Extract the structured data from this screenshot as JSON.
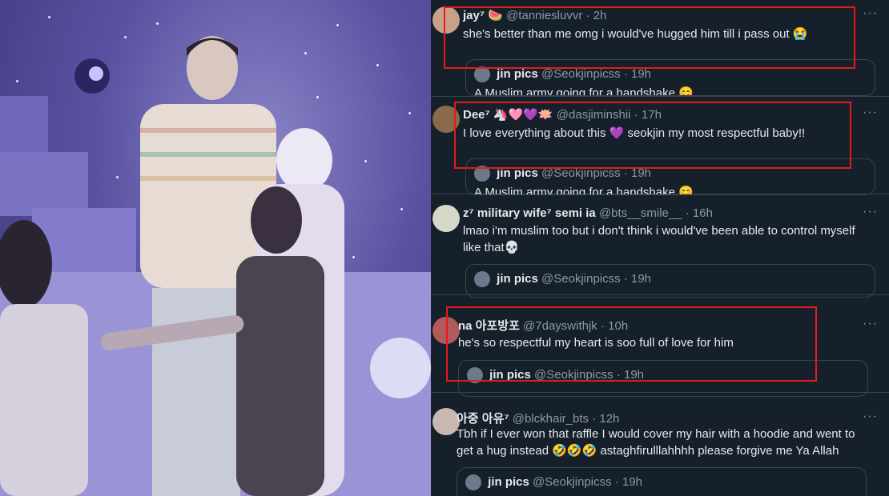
{
  "colors": {
    "feed_bg": "#15202b",
    "text": "#e7e9ea",
    "muted": "#8b98a5",
    "border": "#38444d",
    "highlight_box": "#e21b1b"
  },
  "photo": {
    "icon": "concert-photo"
  },
  "quote_source": {
    "name": "jin pics",
    "handle": "@Seokjinpicss"
  },
  "tweets": [
    {
      "name": "jay⁷",
      "emoji": "🍉",
      "handle": "@tanniesluvvr",
      "time": "· 2h",
      "text": "she's better than me omg i would've hugged him till i pass out 😭",
      "quote_time": "· 19h",
      "quote_text": "A Muslim army going for a handshake 😊",
      "more": "···"
    },
    {
      "name": "Dee⁷",
      "emoji": "🦄🩷💜🪷",
      "handle": "@dasjiminshii",
      "time": "· 17h",
      "text": "I love everything about this 💜 seokjin my most respectful baby!!",
      "quote_time": "· 19h",
      "quote_text": "A Muslim army going for a handshake 😊",
      "more": "···"
    },
    {
      "name": "z⁷ military wife⁷ semi ia",
      "emoji": "",
      "handle": "@bts__smile__",
      "time": "· 16h",
      "text": "lmao i'm muslim too but i don't think i would've been able to control myself like that💀",
      "quote_time": "· 19h",
      "quote_text": "",
      "more": "···"
    },
    {
      "name": "na 아포방포",
      "emoji": "",
      "handle": "@7dayswithjk",
      "time": "· 10h",
      "text": "he's so respectful my heart is soo full of love for him",
      "quote_time": "· 19h",
      "quote_text": "",
      "more": "···"
    },
    {
      "name": "아중 아유⁷",
      "emoji": "",
      "handle": "@blckhair_bts",
      "time": "· 12h",
      "text": "Tbh if I ever won that raffle I would cover my hair with a hoodie and went to get a hug instead 🤣🤣🤣 astaghfirulllahhhh please forgive me Ya Allah",
      "quote_time": "· 19h",
      "quote_text": "",
      "more": "···"
    }
  ]
}
